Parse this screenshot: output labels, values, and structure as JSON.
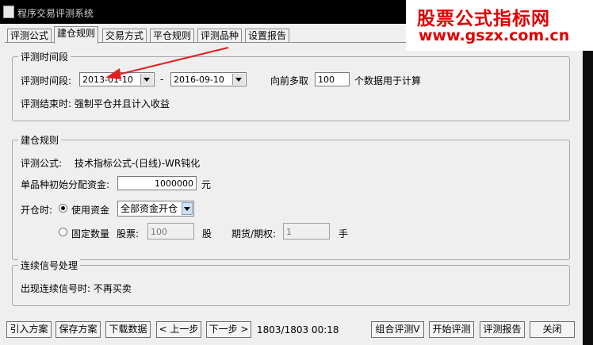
{
  "window": {
    "title": "程序交易评测系统"
  },
  "watermark": {
    "line1": "股票公式指标网",
    "line2": "www.gszx.com.cn"
  },
  "tabs": [
    {
      "label": "评测公式"
    },
    {
      "label": "建仓规则"
    },
    {
      "label": "交易方式"
    },
    {
      "label": "平仓规则"
    },
    {
      "label": "评测品种"
    },
    {
      "label": "设置报告"
    }
  ],
  "period": {
    "legend": "评测时间段",
    "range_label": "评测时间段:",
    "start_date": "2013-01-10",
    "dash": "-",
    "end_date": "2016-09-10",
    "lookback_prefix": "向前多取",
    "lookback_value": "100",
    "lookback_suffix": "个数据用于计算",
    "end_label": "评测结束时: 强制平仓并且计入收益"
  },
  "build": {
    "legend": "建仓规则",
    "formula_label": "评测公式:",
    "formula_value": "技术指标公式-(日线)-WR钝化",
    "capital_label": "单品种初始分配资金:",
    "capital_value": "1000000",
    "capital_unit": "元",
    "open_label": "开仓时:",
    "use_funds_label": "使用资金",
    "use_funds_option": "全部资金开仓",
    "fixed_qty_label": "固定数量",
    "stock_label": "股票:",
    "stock_value": "100",
    "stock_unit": "股",
    "futures_label": "期货/期权:",
    "futures_value": "1",
    "futures_unit": "手"
  },
  "signal": {
    "legend": "连续信号处理",
    "text": "出现连续信号时: 不再买卖"
  },
  "footer": {
    "import_label": "引入方案",
    "save_label": "保存方案",
    "download_label": "下载数据",
    "prev_label": "< 上一步",
    "next_label": "下一步 >",
    "status": "1803/1803 00:18",
    "combo_label": "组合评测V",
    "start_label": "开始评测",
    "report_label": "评测报告",
    "close_label": "关闭"
  },
  "colors": {
    "annotation_arrow": "#e02020",
    "watermark_text": "#e00000"
  }
}
